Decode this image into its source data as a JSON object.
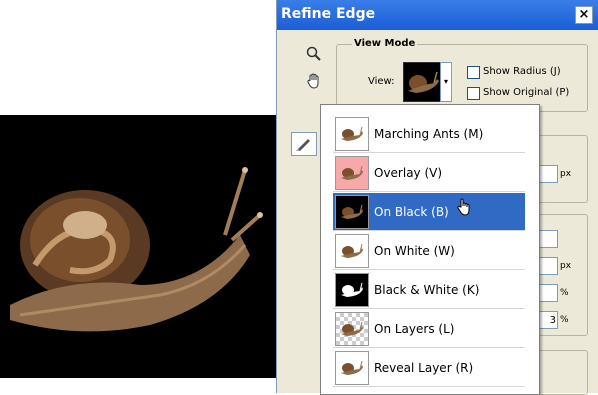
{
  "dialog": {
    "title": "Refine Edge",
    "close_label": "×",
    "view_mode": {
      "group_title": "View Mode",
      "view_label": "View:",
      "arrow": "▾",
      "show_radius_label": "Show Radius (J)",
      "show_original_label": "Show Original (P)"
    },
    "fields": [
      {
        "value": "",
        "unit": "px"
      },
      {
        "value": "",
        "unit": ""
      },
      {
        "value": "",
        "unit": "px"
      },
      {
        "value": "",
        "unit": "%"
      },
      {
        "value": "3",
        "unit": "%"
      }
    ]
  },
  "view_menu": {
    "items": [
      {
        "label": "Marching Ants (M)",
        "thumb": "white"
      },
      {
        "label": "Overlay (V)",
        "thumb": "pink"
      },
      {
        "label": "On Black (B)",
        "thumb": "black",
        "selected": true
      },
      {
        "label": "On White (W)",
        "thumb": "white"
      },
      {
        "label": "Black & White (K)",
        "thumb": "black"
      },
      {
        "label": "On Layers (L)",
        "thumb": "checker"
      },
      {
        "label": "Reveal Layer (R)",
        "thumb": "white"
      }
    ]
  },
  "colors": {
    "selection": "#316ac5",
    "title_bar": "#1b5ed6",
    "overlay": "#f7a9a9"
  }
}
